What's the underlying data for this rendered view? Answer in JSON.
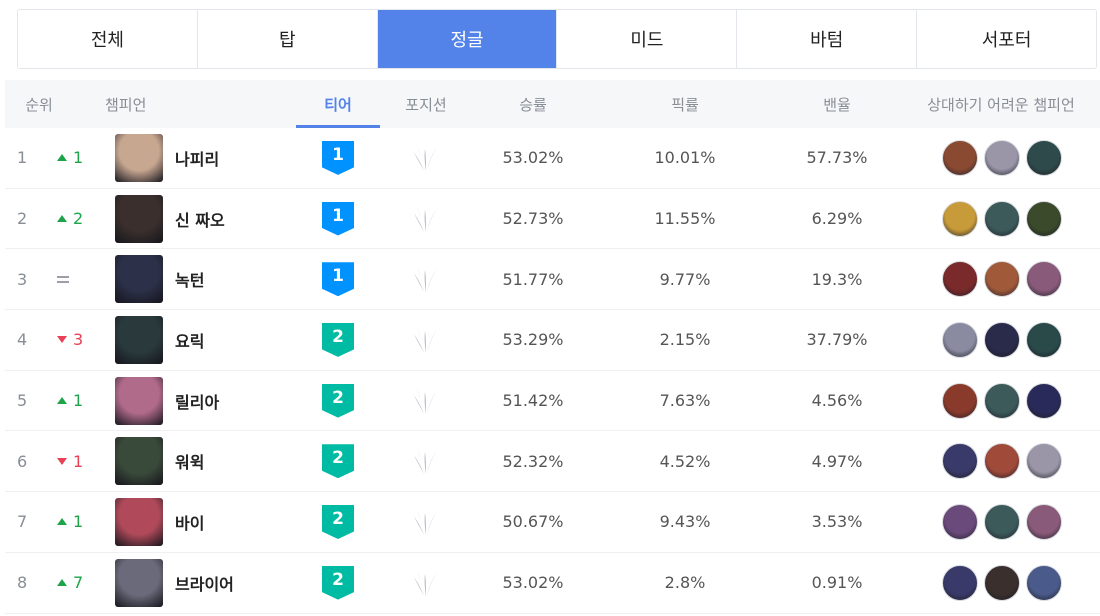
{
  "tabs": [
    {
      "label": "전체",
      "active": false
    },
    {
      "label": "탑",
      "active": false
    },
    {
      "label": "정글",
      "active": true
    },
    {
      "label": "미드",
      "active": false
    },
    {
      "label": "바텀",
      "active": false
    },
    {
      "label": "서포터",
      "active": false
    }
  ],
  "header": {
    "rank": "순위",
    "champion": "챔피언",
    "tier": "티어",
    "position": "포지션",
    "win_rate": "승률",
    "pick_rate": "픽률",
    "ban_rate": "밴율",
    "counter": "상대하기 어려운 챔피언"
  },
  "colors": {
    "accent": "#5383e8",
    "up": "#1fa34a",
    "down": "#e84057",
    "tier1": "#0093ff",
    "tier2": "#00bba3"
  },
  "rows": [
    {
      "rank": "1",
      "change_dir": "up",
      "change": "1",
      "name": "나피리",
      "tier": "1",
      "win": "53.02%",
      "pick": "10.01%",
      "ban": "57.73%",
      "avatar_color": "#c8a791",
      "counters": [
        "#8a4a32",
        "#9a96a8",
        "#2f4a4a"
      ]
    },
    {
      "rank": "2",
      "change_dir": "up",
      "change": "2",
      "name": "신 짜오",
      "tier": "1",
      "win": "52.73%",
      "pick": "11.55%",
      "ban": "6.29%",
      "avatar_color": "#3a2f2c",
      "counters": [
        "#c79a3a",
        "#3c5a5a",
        "#3a4a2a"
      ]
    },
    {
      "rank": "3",
      "change_dir": "same",
      "change": "",
      "name": "녹턴",
      "tier": "1",
      "win": "51.77%",
      "pick": "9.77%",
      "ban": "19.3%",
      "avatar_color": "#2c3048",
      "counters": [
        "#7a2a2a",
        "#a05a3a",
        "#8a5a7a"
      ]
    },
    {
      "rank": "4",
      "change_dir": "down",
      "change": "3",
      "name": "요릭",
      "tier": "2",
      "win": "53.29%",
      "pick": "2.15%",
      "ban": "37.79%",
      "avatar_color": "#2a3a3c",
      "counters": [
        "#8a8aa0",
        "#2a2a4a",
        "#2a4a4a"
      ]
    },
    {
      "rank": "5",
      "change_dir": "up",
      "change": "1",
      "name": "릴리아",
      "tier": "2",
      "win": "51.42%",
      "pick": "7.63%",
      "ban": "4.56%",
      "avatar_color": "#b06a8a",
      "counters": [
        "#8a3a2a",
        "#3c5a5a",
        "#2a2a5a"
      ]
    },
    {
      "rank": "6",
      "change_dir": "down",
      "change": "1",
      "name": "워윅",
      "tier": "2",
      "win": "52.32%",
      "pick": "4.52%",
      "ban": "4.97%",
      "avatar_color": "#3a4a3a",
      "counters": [
        "#3a3a6a",
        "#a04a3a",
        "#9a96a8"
      ]
    },
    {
      "rank": "7",
      "change_dir": "up",
      "change": "1",
      "name": "바이",
      "tier": "2",
      "win": "50.67%",
      "pick": "9.43%",
      "ban": "3.53%",
      "avatar_color": "#b04a5a",
      "counters": [
        "#6a4a7a",
        "#3c5a5a",
        "#8a5a7a"
      ]
    },
    {
      "rank": "8",
      "change_dir": "up",
      "change": "7",
      "name": "브라이어",
      "tier": "2",
      "win": "53.02%",
      "pick": "2.8%",
      "ban": "0.91%",
      "avatar_color": "#6a6a7a",
      "counters": [
        "#3a3a6a",
        "#3a2f2c",
        "#4a5a8a"
      ]
    }
  ]
}
